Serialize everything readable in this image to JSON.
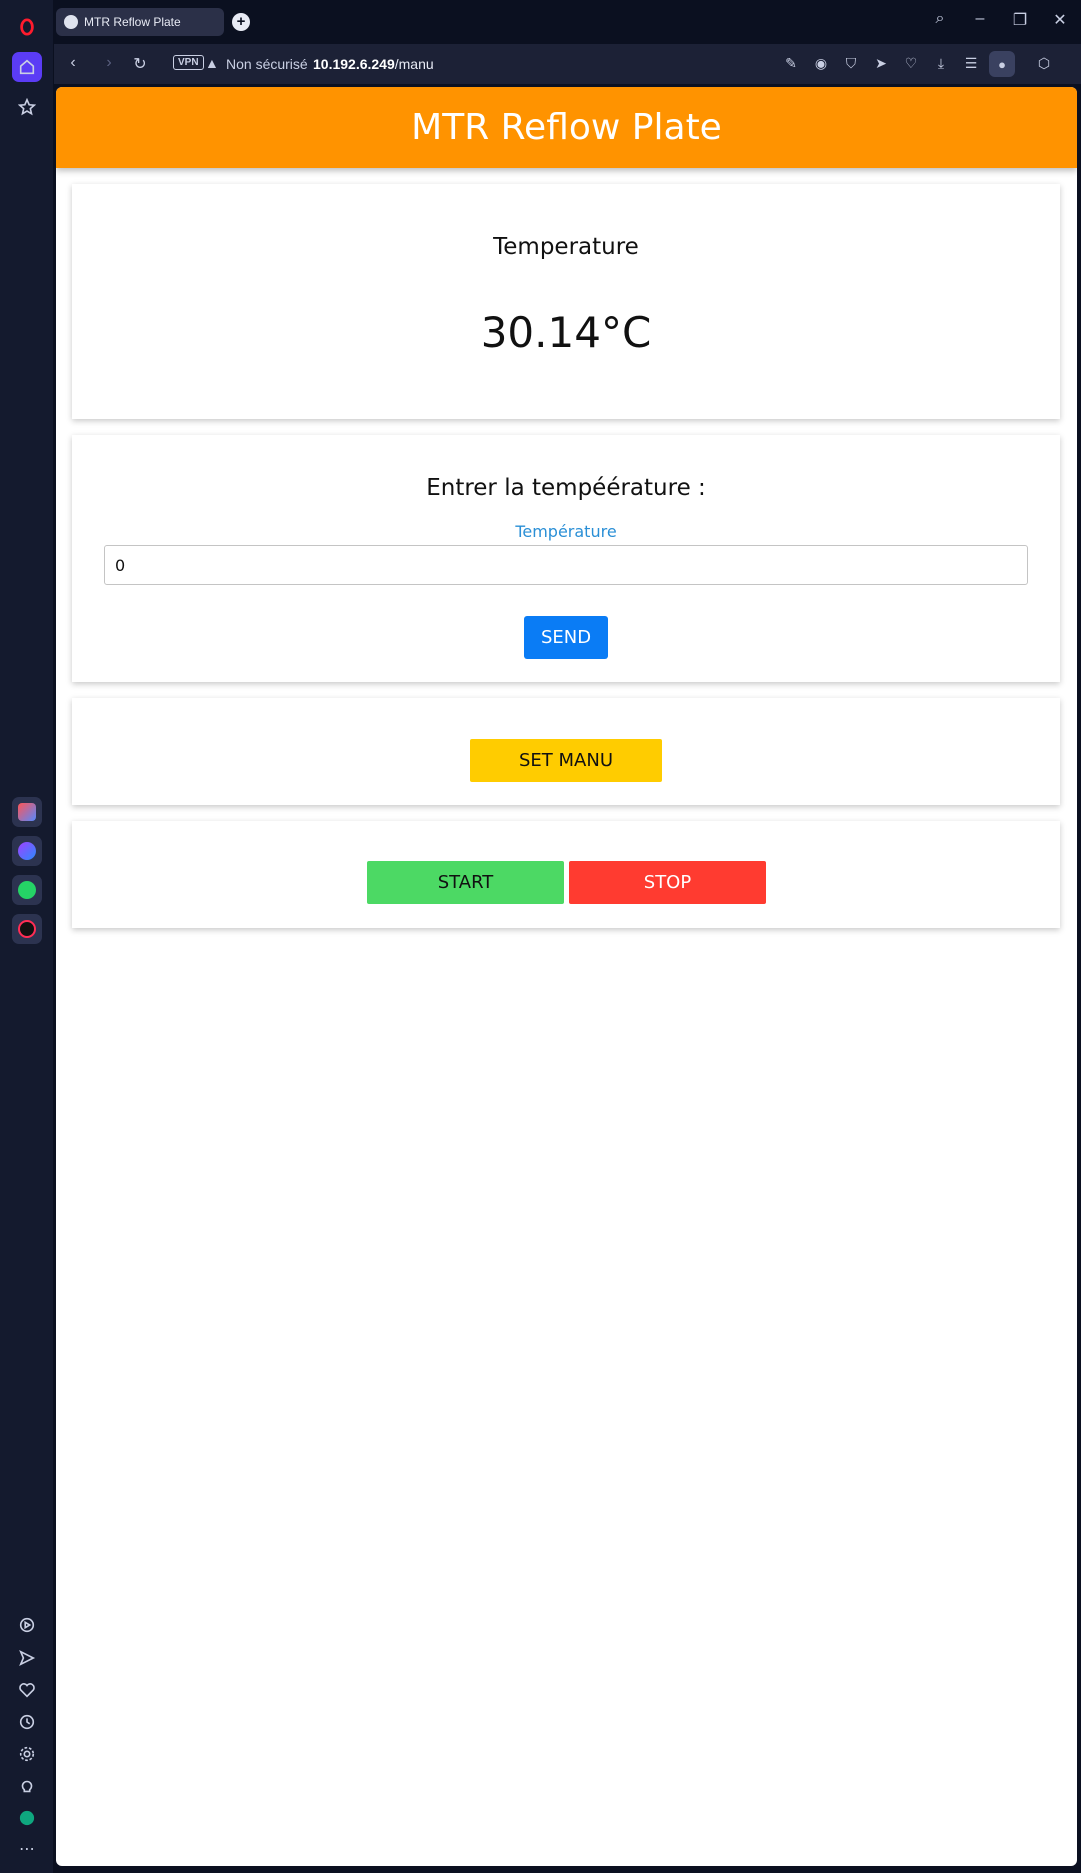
{
  "browser": {
    "tab_title": "MTR Reflow Plate",
    "vpn_label": "VPN",
    "security_text": "Non sécurisé",
    "url_host": "10.192.6.249",
    "url_path": "/manu"
  },
  "page": {
    "header_title": "MTR Reflow Plate",
    "temperature_card": {
      "label": "Temperature",
      "value": "30.14°C"
    },
    "entry_card": {
      "title": "Entrer la tempéérature :",
      "field_label": "Température",
      "input_value": "0",
      "send_label": "SEND"
    },
    "mode_card": {
      "set_manu_label": "SET MANU"
    },
    "control_card": {
      "start_label": "START",
      "stop_label": "STOP"
    }
  },
  "colors": {
    "header": "#ff9300",
    "send": "#0a7cf5",
    "set_manu": "#ffcc00",
    "start": "#4cd964",
    "stop": "#ff3b30",
    "field_label": "#2a8fd6"
  }
}
